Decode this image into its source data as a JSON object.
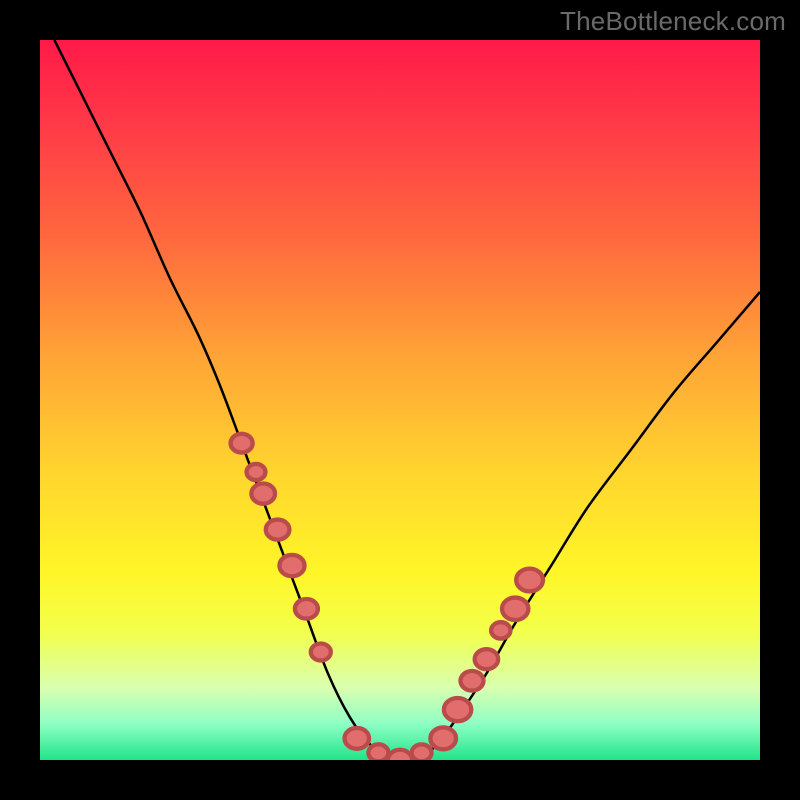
{
  "watermark": "TheBottleneck.com",
  "chart_data": {
    "type": "line",
    "title": "",
    "xlabel": "",
    "ylabel": "",
    "xlim": [
      0,
      100
    ],
    "ylim": [
      0,
      100
    ],
    "grid": false,
    "legend": false,
    "series": [
      {
        "name": "bottleneck-curve",
        "x": [
          2,
          6,
          10,
          14,
          18,
          22,
          25,
          28,
          31,
          34,
          37,
          40,
          43,
          46,
          49,
          52,
          55,
          58,
          62,
          66,
          71,
          76,
          82,
          88,
          94,
          100
        ],
        "values": [
          100,
          92,
          84,
          76,
          67,
          59,
          52,
          44,
          36,
          28,
          20,
          12,
          6,
          2,
          0,
          0,
          2,
          6,
          12,
          19,
          27,
          35,
          43,
          51,
          58,
          65
        ]
      }
    ],
    "markers": {
      "name": "highlight-points",
      "x": [
        28,
        30,
        31,
        33,
        35,
        37,
        39,
        44,
        47,
        50,
        53,
        56,
        58,
        60,
        62,
        64,
        66,
        68
      ],
      "values": [
        44,
        40,
        37,
        32,
        27,
        21,
        15,
        3,
        1,
        0,
        1,
        3,
        7,
        11,
        14,
        18,
        21,
        25
      ]
    },
    "gradient_bands": [
      {
        "pos": 0.0,
        "color": "#ff1a49"
      },
      {
        "pos": 0.28,
        "color": "#ff6a3e"
      },
      {
        "pos": 0.6,
        "color": "#ffd52e"
      },
      {
        "pos": 0.82,
        "color": "#f3ff4a"
      },
      {
        "pos": 0.95,
        "color": "#8effc4"
      },
      {
        "pos": 1.0,
        "color": "#20e48a"
      }
    ]
  }
}
